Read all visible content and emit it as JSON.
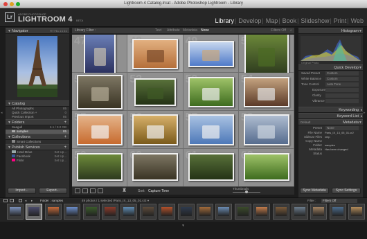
{
  "window": {
    "title": "Lightroom 4 Catalog.lrcat - Adobe Photoshop Lightroom - Library"
  },
  "identity": {
    "top": "ADOBE PHOTOSHOP",
    "name": "LIGHTROOM 4",
    "beta": "BETA"
  },
  "modules": [
    "Library",
    "Develop",
    "Map",
    "Book",
    "Slideshow",
    "Print",
    "Web"
  ],
  "left": {
    "navigator": {
      "title": "Navigator",
      "zoom": [
        "FIT",
        "FILL",
        "1:1",
        "3:1"
      ]
    },
    "catalog": {
      "title": "Catalog",
      "items": [
        {
          "label": "All Photographs",
          "count": "85"
        },
        {
          "label": "Quick Collection +",
          "count": "0"
        },
        {
          "label": "Previous Import",
          "count": "85"
        }
      ]
    },
    "folders": {
      "title": "Folders",
      "volume": "Seagull",
      "volume_info": "6.1 / 9.0 GB",
      "items": [
        {
          "label": "samples",
          "count": "85"
        }
      ]
    },
    "collections": {
      "title": "Collections",
      "items": [
        {
          "label": "Smart Collections"
        }
      ]
    },
    "publish": {
      "title": "Publish Services",
      "items": [
        {
          "label": "Hard Drive",
          "action": "Set Up..."
        },
        {
          "label": "Facebook",
          "action": "Set Up..."
        },
        {
          "label": "Flickr",
          "action": "Set Up..."
        }
      ]
    },
    "import_label": "Import...",
    "export_label": "Export..."
  },
  "filterbar": {
    "title": "Library Filter :",
    "options": [
      "Text",
      "Attribute",
      "Metadata",
      "None"
    ],
    "preset": "Filters Off"
  },
  "grid": {
    "cell_numbers": [
      "47",
      "48",
      "49",
      "50",
      "51",
      "52",
      "53",
      "54",
      "55",
      "56",
      "57",
      "58",
      "59",
      "60",
      "61",
      "62"
    ]
  },
  "toolbar": {
    "sort_label": "Sort:",
    "sort_value": "Capture Time",
    "thumbnails_label": "Thumbnails"
  },
  "right": {
    "histogram": {
      "title": "Histogram",
      "info": "Original Photo"
    },
    "quick_develop": {
      "title": "Quick Develop",
      "rows": [
        {
          "label": "Saved Preset",
          "value": "Custom"
        },
        {
          "label": "White Balance",
          "value": "Custom"
        },
        {
          "label": "Tone Control",
          "value": "Auto Tone"
        },
        {
          "label": "Exposure",
          "value": ""
        },
        {
          "label": "Clarity",
          "value": ""
        },
        {
          "label": "Vibrance",
          "value": ""
        }
      ]
    },
    "keywording": {
      "title": "Keywording"
    },
    "keyword_list": {
      "title": "Keyword List"
    },
    "metadata": {
      "title": "Metadata",
      "preset_label": "Default",
      "rows": [
        {
          "label": "Preset",
          "value": "None"
        },
        {
          "label": "File Name",
          "value": "Paris_IX_13_05_01.cr2"
        },
        {
          "label": "Sidecar Files",
          "value": "xmp"
        },
        {
          "label": "Copy Name",
          "value": ""
        },
        {
          "label": "Folder",
          "value": "samples"
        },
        {
          "label": "Metadata Status",
          "value": "Has been changed"
        }
      ]
    },
    "sync_metadata_label": "Sync Metadata",
    "sync_settings_label": "Sync Settings"
  },
  "filmstrip": {
    "source": "Folder : samples",
    "info": "49 photos / 1 selected /Paris_IX_13_05_01.cr2 ▾",
    "filter_label": "Filter :",
    "filter_value": "Filters Off"
  },
  "colors": {
    "accent": "#eeeeee",
    "grid_bg": "#909090",
    "panel": "#2e2e2e"
  }
}
